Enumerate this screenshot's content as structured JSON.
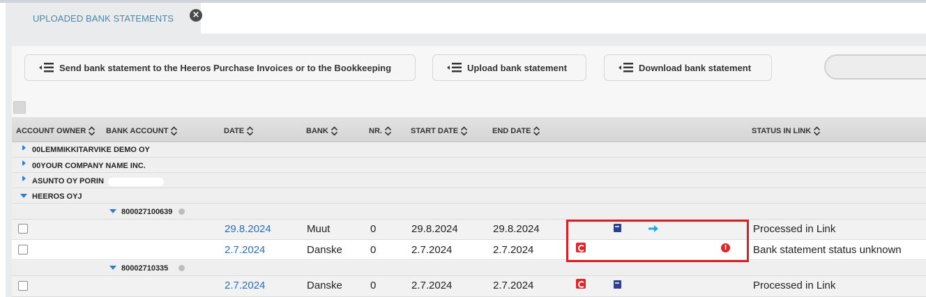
{
  "tab": {
    "label": "UPLOADED BANK STATEMENTS",
    "close_symbol": "×"
  },
  "toolbar": {
    "send_label": "Send bank statement to the Heeros Purchase Invoices or to the Bookkeeping",
    "upload_label": "Upload bank statement",
    "download_label": "Download bank statement"
  },
  "columns": {
    "account_owner": "ACCOUNT OWNER",
    "bank_account": "BANK ACCOUNT",
    "date": "DATE",
    "bank": "BANK",
    "nr": "NR.",
    "start_date": "START DATE",
    "end_date": "END DATE",
    "status": "STATUS IN LINK"
  },
  "groups": [
    {
      "name": "00LEMMIKKITARVIKE DEMO OY",
      "expanded": false
    },
    {
      "name": "00YOUR COMPANY NAME INC.",
      "expanded": false
    },
    {
      "name": "ASUNTO OY PORIN",
      "expanded": false
    },
    {
      "name": "HEEROS OYJ",
      "expanded": true
    }
  ],
  "accounts": [
    {
      "number": "800027100639",
      "rows": [
        {
          "date": "29.8.2024",
          "bank": "Muut",
          "nr": "0",
          "start": "29.8.2024",
          "end": "29.8.2024",
          "status": "Processed in Link",
          "icons": [
            "book-icon",
            "arrow-right-icon"
          ]
        },
        {
          "date": "2.7.2024",
          "bank": "Danske",
          "nr": "0",
          "start": "2.7.2024",
          "end": "2.7.2024",
          "status": "Bank statement status unknown",
          "icons": [
            "red-square-icon",
            "error-icon"
          ]
        }
      ]
    },
    {
      "number": "80002710335",
      "rows": [
        {
          "date": "2.7.2024",
          "bank": "Danske",
          "nr": "0",
          "start": "2.7.2024",
          "end": "2.7.2024",
          "status": "Processed in Link",
          "icons": [
            "red-square-icon",
            "book-icon"
          ]
        }
      ]
    }
  ],
  "colors": {
    "accent": "#2a6ebb",
    "highlight": "#d81f26",
    "tab_text": "#4d86a8"
  }
}
